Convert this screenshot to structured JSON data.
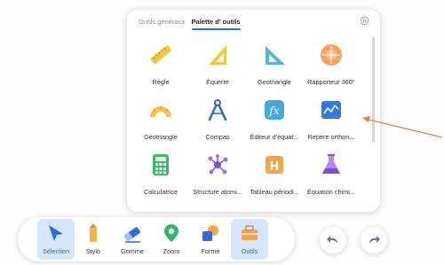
{
  "palette": {
    "tabs": [
      {
        "label": "Outils généraux",
        "active": false
      },
      {
        "label": "Palette d’ outils",
        "active": true
      }
    ],
    "settings_icon": "gear-icon",
    "tools": [
      {
        "label": "Règle",
        "icon": "ruler-icon"
      },
      {
        "label": "Équerre",
        "icon": "set-square-icon"
      },
      {
        "label": "Geotriangle",
        "icon": "geotriangle-icon"
      },
      {
        "label": "Rapporteur 360°",
        "icon": "protractor-360-icon"
      },
      {
        "label": "Géotriangle",
        "icon": "protractor-icon"
      },
      {
        "label": "Compas",
        "icon": "compass-icon"
      },
      {
        "label": "Éditeur d'équat...",
        "icon": "equation-editor-icon"
      },
      {
        "label": "Repère orthon...",
        "icon": "coordinate-system-icon"
      },
      {
        "label": "Calculatrice",
        "icon": "calculator-icon"
      },
      {
        "label": "Structure atomi...",
        "icon": "molecule-icon"
      },
      {
        "label": "Tableau périodi...",
        "icon": "periodic-table-icon"
      },
      {
        "label": "Équation chimi...",
        "icon": "chemistry-flask-icon"
      }
    ]
  },
  "toolbar": {
    "items": [
      {
        "label": "Sélection",
        "icon": "cursor-icon",
        "selected": true
      },
      {
        "label": "Stylo",
        "icon": "pen-icon",
        "selected": false
      },
      {
        "label": "Gomme",
        "icon": "eraser-icon",
        "selected": false
      },
      {
        "label": "Zoom",
        "icon": "zoom-pin-icon",
        "selected": false
      },
      {
        "label": "Forme",
        "icon": "shapes-icon",
        "selected": false
      },
      {
        "label": "Outils",
        "icon": "toolbox-icon",
        "selected": true
      }
    ],
    "undo_icon": "undo-icon",
    "redo_icon": "redo-icon"
  },
  "colors": {
    "accent": "#2f6bd9",
    "selected_bg": "#d6e6fb",
    "annotation_arrow": "#d9844e"
  }
}
